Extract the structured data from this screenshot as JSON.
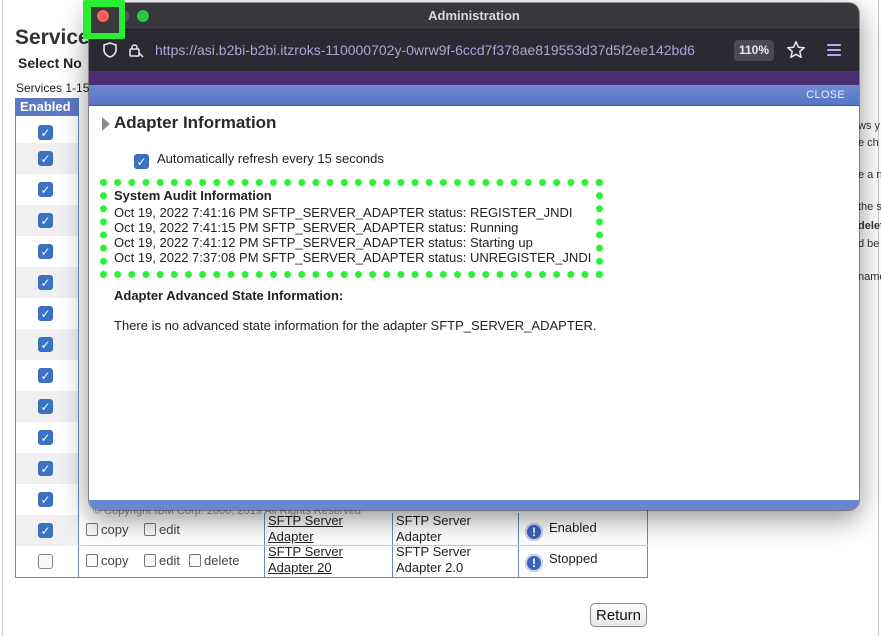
{
  "background_page": {
    "title": "Service",
    "subtitle": "Select No",
    "count_text": "Services 1-15",
    "enabled_header": "Enabled",
    "right_fragments": [
      "ws y",
      "e ch",
      "e a n",
      "the s",
      "delet",
      "d be",
      "name"
    ],
    "footer_fragment": "© Copyright IBM Corp. 2000, 2019 All Rights Reserved",
    "visible_rows": [
      {
        "checked": true,
        "actions": [
          "copy",
          "edit"
        ],
        "name": [
          "SFTP Server",
          "Adapter"
        ],
        "type": [
          "SFTP Server",
          "Adapter"
        ],
        "status": "Enabled"
      },
      {
        "checked": false,
        "actions": [
          "copy",
          "edit",
          "delete"
        ],
        "name": [
          "SFTP Server",
          "Adapter 20"
        ],
        "type": [
          "SFTP Server",
          "Adapter 2.0"
        ],
        "status": "Stopped"
      }
    ],
    "return_button": "Return"
  },
  "window": {
    "title": "Administration",
    "url": "https://asi.b2bi-b2bi.itzroks-110000702y-0wrw9f-6ccd7f378ae819553d37d5f2ee142bd6",
    "zoom": "110%",
    "close_link": "CLOSE"
  },
  "adapter_info": {
    "section_title": "Adapter Information",
    "auto_refresh_label": "Automatically refresh every 15 seconds",
    "auto_refresh_checked": true,
    "audit_title": "System Audit Information",
    "audit_lines": [
      "Oct 19, 2022 7:41:16 PM SFTP_SERVER_ADAPTER status: REGISTER_JNDI",
      "Oct 19, 2022 7:41:15 PM SFTP_SERVER_ADAPTER status: Running",
      "Oct 19, 2022 7:41:12 PM SFTP_SERVER_ADAPTER status: Starting up",
      "Oct 19, 2022 7:37:08 PM SFTP_SERVER_ADAPTER status: UNREGISTER_JNDI"
    ],
    "advanced_title": "Adapter Advanced State Information:",
    "advanced_text": "There is no advanced state information for the adapter SFTP_SERVER_ADAPTER."
  },
  "colors": {
    "highlight": "#2ef03a",
    "blue_bar": "#6f8ad2",
    "url_text": "#a8a6d6",
    "purple_strip": "#4a2f73"
  }
}
